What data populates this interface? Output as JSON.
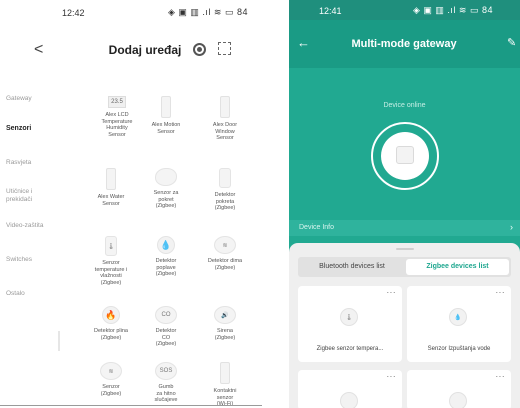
{
  "left_screen": {
    "status": {
      "time": "12:42",
      "icons": "◈ ▣ ▥ .ıl ≋ ▭ 84"
    },
    "header": {
      "back_glyph": "<",
      "title": "Dodaj uređaj"
    },
    "categories": [
      {
        "label": "Gateway",
        "active": false
      },
      {
        "label": "Senzori",
        "active": true
      },
      {
        "label": "Rasvjeta",
        "active": false
      },
      {
        "label": "Utičnice i prekidači",
        "active": false
      },
      {
        "label": "Video-zaštita",
        "active": false
      },
      {
        "label": "Switches",
        "active": false
      },
      {
        "label": "Ostalo",
        "active": false
      }
    ],
    "tiles": [
      {
        "name": "Alex LCD\nTemperature\nHumidity\nSensor",
        "icon": "lcd-sensor-icon",
        "glyph": "23.5"
      },
      {
        "name": "Alex Motion\nSensor",
        "icon": "motion-sensor-icon",
        "glyph": ""
      },
      {
        "name": "Alex Door\nWindow\nSensor",
        "icon": "door-sensor-icon",
        "glyph": ""
      },
      {
        "name": "Alex Water\nSensor",
        "icon": "water-sensor-icon",
        "glyph": ""
      },
      {
        "name": "Senzor za\npokret\n(Zigbee)",
        "icon": "pir-sensor-icon",
        "glyph": ""
      },
      {
        "name": "Detektor\npokreta\n(Zigbee)",
        "icon": "motion-detector-icon",
        "glyph": ""
      },
      {
        "name": "Senzor\ntemperature i\nvlažnosti\n(Zigbee)",
        "icon": "temp-humidity-icon",
        "glyph": "🌡"
      },
      {
        "name": "Detektor\npoplave\n(Zigbee)",
        "icon": "water-leak-icon",
        "glyph": "💧"
      },
      {
        "name": "Detektor dima\n(Zigbee)",
        "icon": "smoke-detector-icon",
        "glyph": "≋"
      },
      {
        "name": "Detektor plina\n(Zigbee)",
        "icon": "gas-detector-icon",
        "glyph": "🔥"
      },
      {
        "name": "Detektor\nCO\n(Zigbee)",
        "icon": "co-detector-icon",
        "glyph": "CO"
      },
      {
        "name": "Sirena\n(Zigbee)",
        "icon": "siren-icon",
        "glyph": "🔊"
      },
      {
        "name": "Senzor\n(Zigbee)",
        "icon": "sensor-icon",
        "glyph": "≋"
      },
      {
        "name": "Gumb\nza hitno\nslučajeve",
        "icon": "sos-button-icon",
        "glyph": "SOS"
      },
      {
        "name": "Kontaktni\nsenzor\n(Wi-Fi)",
        "icon": "contact-sensor-icon",
        "glyph": ""
      }
    ]
  },
  "right_screen": {
    "status": {
      "time": "12:41",
      "icons": "◈ ▣ ▥ .ıl ≋ ▭ 84"
    },
    "header": {
      "back_glyph": "←",
      "title": "Multi-mode gateway",
      "edit_glyph": "✎"
    },
    "online_text": "Device online",
    "device_info_label": "Device Info",
    "device_info_arrow": "›",
    "tabs": [
      {
        "label": "Bluetooth devices list",
        "active": false
      },
      {
        "label": "Zigbee devices list",
        "active": true
      }
    ],
    "devices": [
      {
        "label": "Zigbee senzor tempera...",
        "icon": "thermometer-icon",
        "glyph": "🌡"
      },
      {
        "label": "Senzor Izpuštanja vode",
        "icon": "water-drop-icon",
        "glyph": "💧"
      },
      {
        "label": "",
        "icon": "sensor-icon",
        "glyph": ""
      },
      {
        "label": "",
        "icon": "sensor-icon",
        "glyph": ""
      }
    ],
    "more_glyph": "···",
    "colors": {
      "primary": "#21a991",
      "header": "#1a9b85",
      "active_tab_text": "#1ea78f",
      "panel": "#efefef"
    }
  }
}
